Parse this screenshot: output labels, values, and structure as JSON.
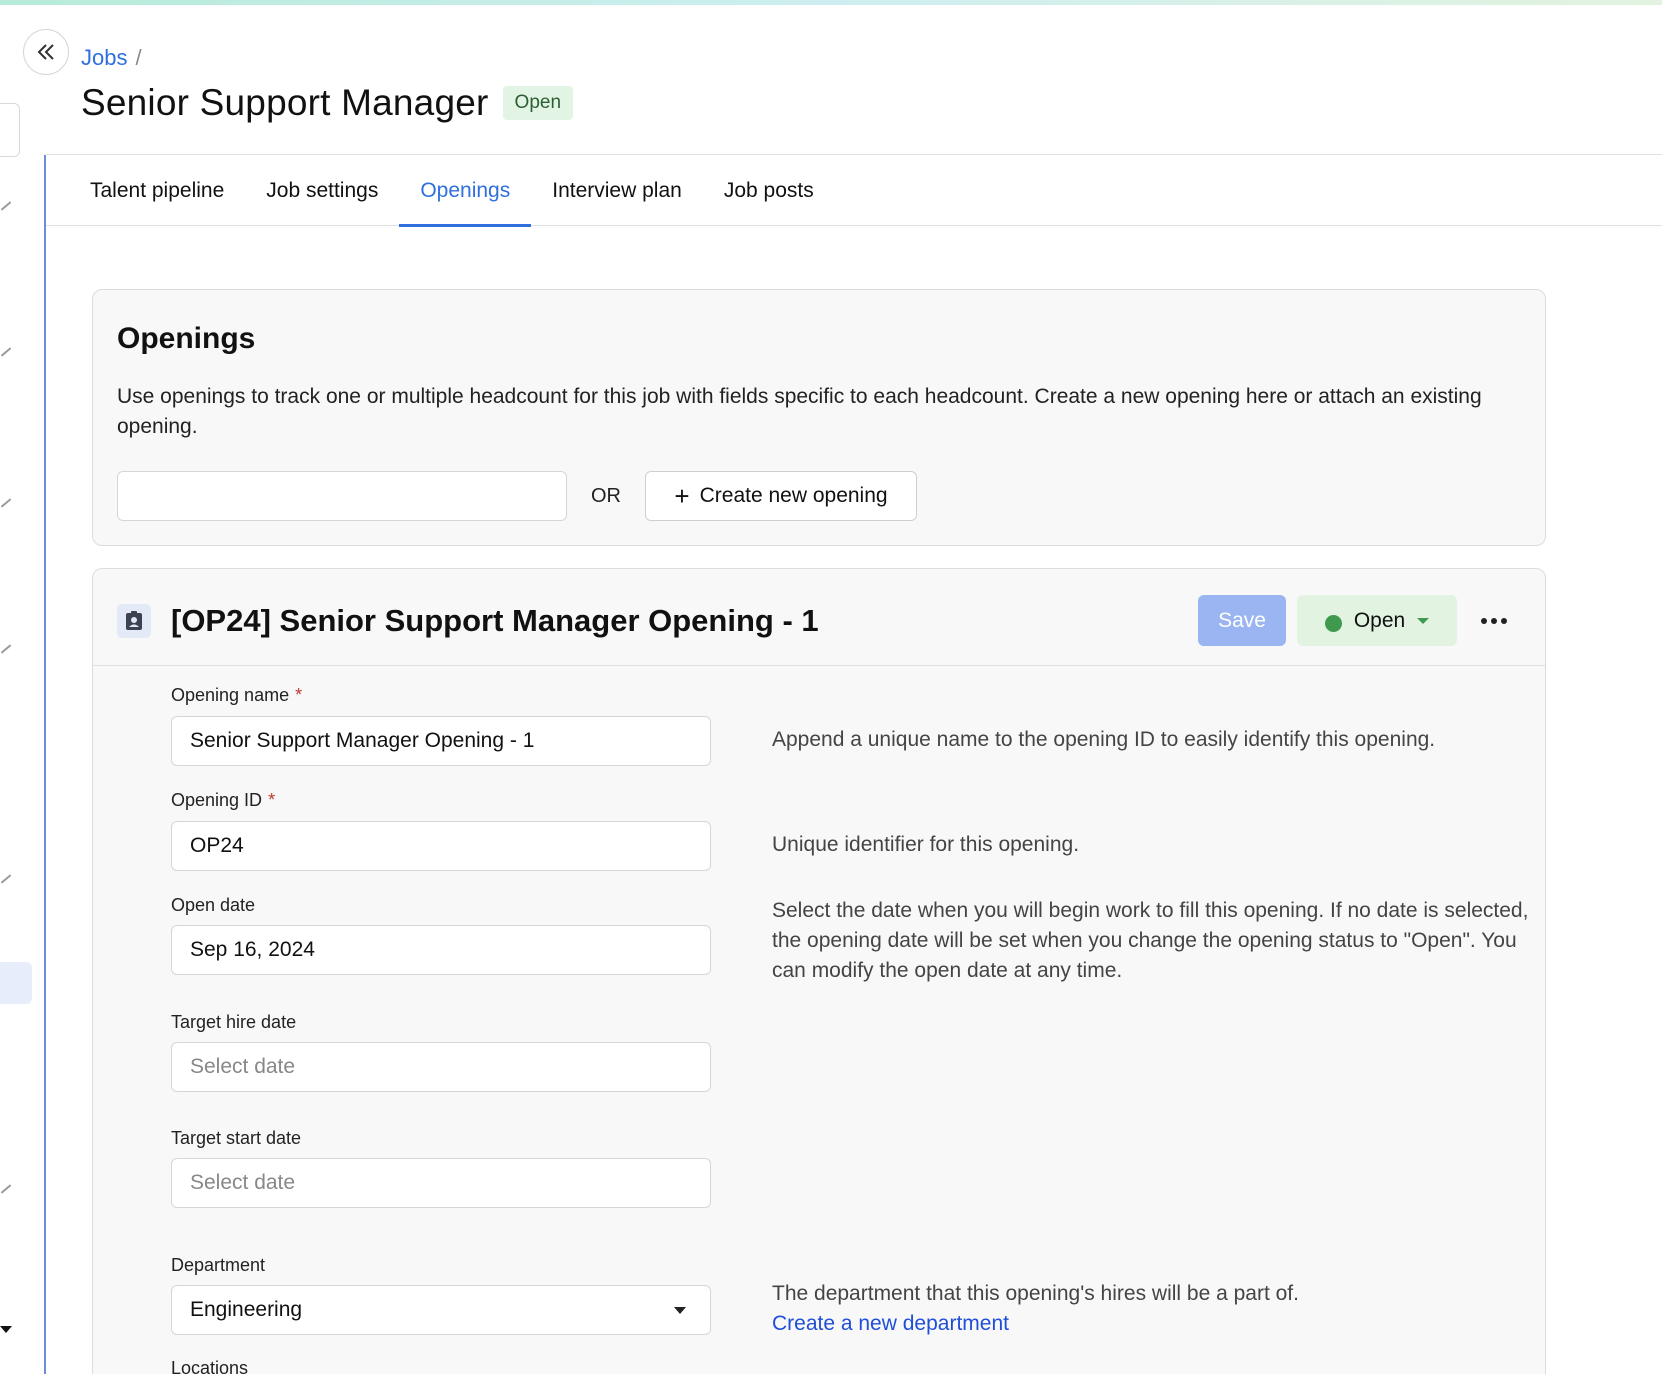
{
  "breadcrumb": {
    "jobs": "Jobs",
    "separator": "/"
  },
  "header": {
    "title": "Senior Support Manager",
    "status": "Open"
  },
  "tabs": [
    {
      "label": "Talent pipeline"
    },
    {
      "label": "Job settings"
    },
    {
      "label": "Openings",
      "active": true
    },
    {
      "label": "Interview plan"
    },
    {
      "label": "Job posts"
    }
  ],
  "openings_section": {
    "title": "Openings",
    "description": "Use openings to track one or multiple headcount for this job with fields specific to each headcount. Create a new opening here or attach an existing opening.",
    "attach_value": "",
    "or_label": "OR",
    "create_label": "Create new opening"
  },
  "opening": {
    "title": "[OP24] Senior Support Manager Opening - 1",
    "save_label": "Save",
    "status_label": "Open",
    "status_color": "#3f9a4f",
    "fields": {
      "name": {
        "label": "Opening name",
        "required": "*",
        "value": "Senior Support Manager Opening - 1",
        "help": "Append a unique name to the opening ID to easily identify this opening."
      },
      "id": {
        "label": "Opening ID",
        "required": "*",
        "value": "OP24",
        "help": "Unique identifier for this opening."
      },
      "open_date": {
        "label": "Open date",
        "value": "Sep 16, 2024",
        "help": "Select the date when you will begin work to fill this opening. If no date is selected, the opening date will be set when you change the opening status to \"Open\". You can modify the open date at any time."
      },
      "target_hire_date": {
        "label": "Target hire date",
        "placeholder": "Select date"
      },
      "target_start_date": {
        "label": "Target start date",
        "placeholder": "Select date"
      },
      "department": {
        "label": "Department",
        "value": "Engineering",
        "help": "The department that this opening's hires will be a part of.",
        "link": "Create a new department"
      },
      "locations": {
        "label": "Locations"
      }
    }
  },
  "colors": {
    "accent": "#2f6fde",
    "save_disabled": "#9bb5f2",
    "badge_bg": "#e2f4e4"
  }
}
